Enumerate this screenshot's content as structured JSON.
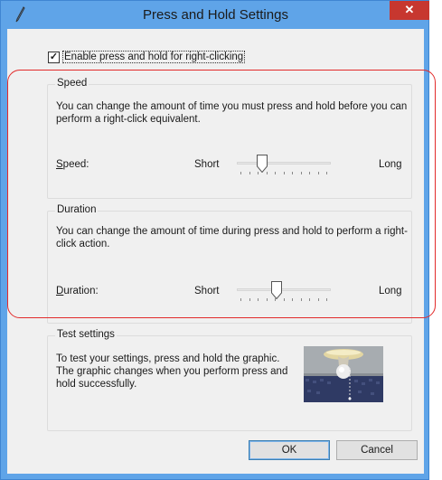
{
  "window": {
    "title": "Press and Hold Settings",
    "close_glyph": "✕"
  },
  "enable": {
    "label": "Enable press and hold for right-clicking",
    "checked": true,
    "check_glyph": "✓"
  },
  "speed": {
    "group_title": "Speed",
    "description": "You can change the amount of time you must press and hold before you can perform a right-click equivalent.",
    "row_label_underlined": "S",
    "row_label_rest": "peed:",
    "short_label": "Short",
    "long_label": "Long",
    "slider_value": 0.25
  },
  "duration": {
    "group_title": "Duration",
    "description": "You can change the amount of time during press and hold to perform a right-click action.",
    "row_label_underlined": "D",
    "row_label_rest": "uration:",
    "short_label": "Short",
    "long_label": "Long",
    "slider_value": 0.42
  },
  "test": {
    "group_title": "Test settings",
    "description": "To test your settings, press and hold the graphic. The graphic changes when you perform press and hold successfully."
  },
  "buttons": {
    "ok": "OK",
    "cancel": "Cancel"
  },
  "colors": {
    "titlebar": "#5fa4e8",
    "close": "#c7372f",
    "client": "#f0f0f0",
    "annotation": "#e22b2b"
  }
}
